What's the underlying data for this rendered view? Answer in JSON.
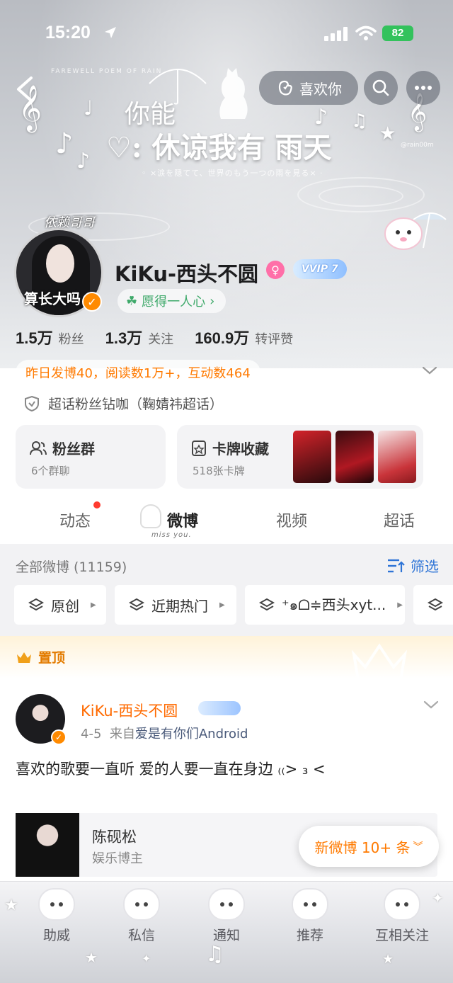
{
  "status_bar": {
    "time": "15:20",
    "battery": "82"
  },
  "header": {
    "like_label": "喜欢你"
  },
  "banner": {
    "line1": "你能",
    "line2": "♡: 休谅我有 雨天",
    "subline": "◦ ×涙を隠てて、世界のもう一つの雨を見る× ·",
    "tiny": "FAREWELL POEM OF RAIN",
    "handle": "@rain00m"
  },
  "profile": {
    "avatar_tag_top": "依赖哥哥",
    "avatar_tag_bottom": "算长大吗",
    "username": "KiKu-西头不圆",
    "vip_badge": "VVIP 7",
    "motto": "愿得一人心",
    "stats": [
      {
        "value": "1.5万",
        "label": "粉丝"
      },
      {
        "value": "1.3万",
        "label": "关注"
      },
      {
        "value": "160.9万",
        "label": "转评赞"
      }
    ],
    "activity": "昨日发博40，阅读数1万+，互动数464",
    "super_badge": "超话粉丝钻咖（鞠婧祎超话）"
  },
  "cards": {
    "fans_group": {
      "title": "粉丝群",
      "sub": "6个群聊"
    },
    "card_collection": {
      "title": "卡牌收藏",
      "sub": "518张卡牌"
    }
  },
  "tabs": [
    {
      "label": "动态"
    },
    {
      "label": "微博"
    },
    {
      "label": "视频"
    },
    {
      "label": "超话"
    }
  ],
  "tab_deco": "miss you.",
  "feed": {
    "header": "全部微博 (11159)",
    "filter": "筛选",
    "chips": [
      "原创",
      "近期热门",
      "⁺๑ᗝ≑西头xyt..."
    ]
  },
  "pinned": {
    "label": "置顶",
    "author": "KiKu-西头不圆",
    "date": "4-5",
    "source_prefix": "来自",
    "source": "爱是有你们Android",
    "body": "喜欢的歌要一直听 爱的人要一直在身边 ₍₍>  ₃  <",
    "repost": {
      "name": "陈砚松",
      "sub": "娱乐博主"
    }
  },
  "new_posts": "新微博 10+ 条",
  "bottom_bar": [
    {
      "label": "助威"
    },
    {
      "label": "私信"
    },
    {
      "label": "通知"
    },
    {
      "label": "推荐"
    },
    {
      "label": "互相关注"
    }
  ],
  "colors": {
    "accent": "#ff7a00",
    "link": "#2e74d6",
    "green": "#3ea96a"
  }
}
